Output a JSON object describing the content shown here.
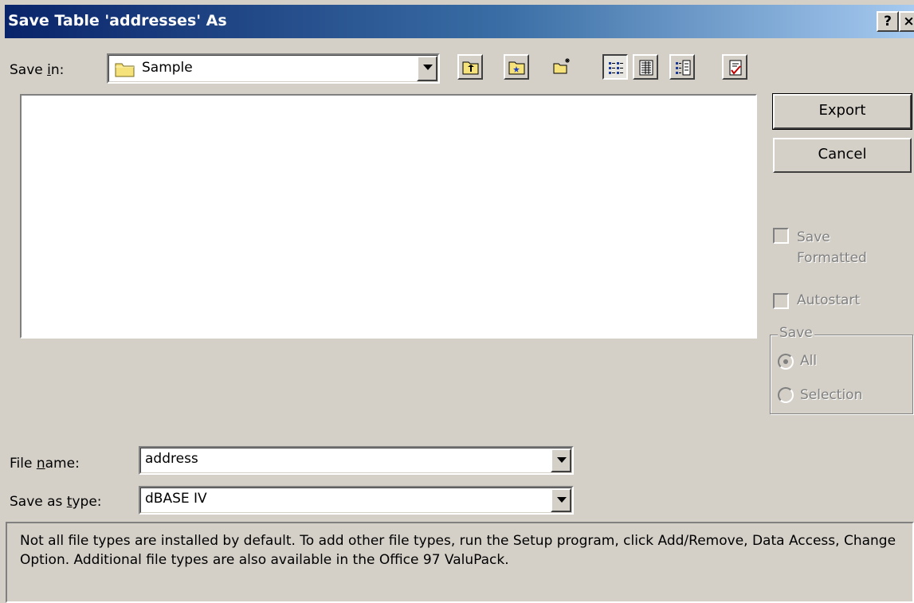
{
  "dialog": {
    "title": "Save Table 'addresses' As",
    "help_button": "?",
    "close_button": "×"
  },
  "save_in": {
    "label_pre": "Save ",
    "label_accel": "i",
    "label_post": "n:",
    "value": "Sample",
    "icon": "folder-icon"
  },
  "toolbar": {
    "items": [
      {
        "name": "up-one-level-icon"
      },
      {
        "name": "search-web-icon"
      },
      {
        "name": "create-new-folder-icon"
      },
      {
        "name": "list-view-icon"
      },
      {
        "name": "details-view-icon"
      },
      {
        "name": "properties-view-icon"
      },
      {
        "name": "commands-and-settings-icon"
      }
    ]
  },
  "buttons": {
    "export": "Export",
    "cancel": "Cancel"
  },
  "options": {
    "save_formatted_line1": "Save",
    "save_formatted_line2": "Formatted",
    "autostart": "Autostart",
    "save_group": "Save",
    "all": "All",
    "selection": "Selection"
  },
  "file_name": {
    "label_pre": "File ",
    "label_accel": "n",
    "label_post": "ame:",
    "value": "address"
  },
  "save_as_type": {
    "label_pre": "Save as ",
    "label_accel": "t",
    "label_post": "ype:",
    "value": "dBASE IV"
  },
  "info": {
    "text": "Not all file types are installed by default.  To add other file types, run the Setup program, click Add/Remove, Data Access, Change Option.  Additional file types are also available in the Office 97 ValuPack."
  },
  "colors": {
    "title_start": "#0a246a",
    "title_end": "#a6caf0",
    "face": "#d4d0c8"
  }
}
